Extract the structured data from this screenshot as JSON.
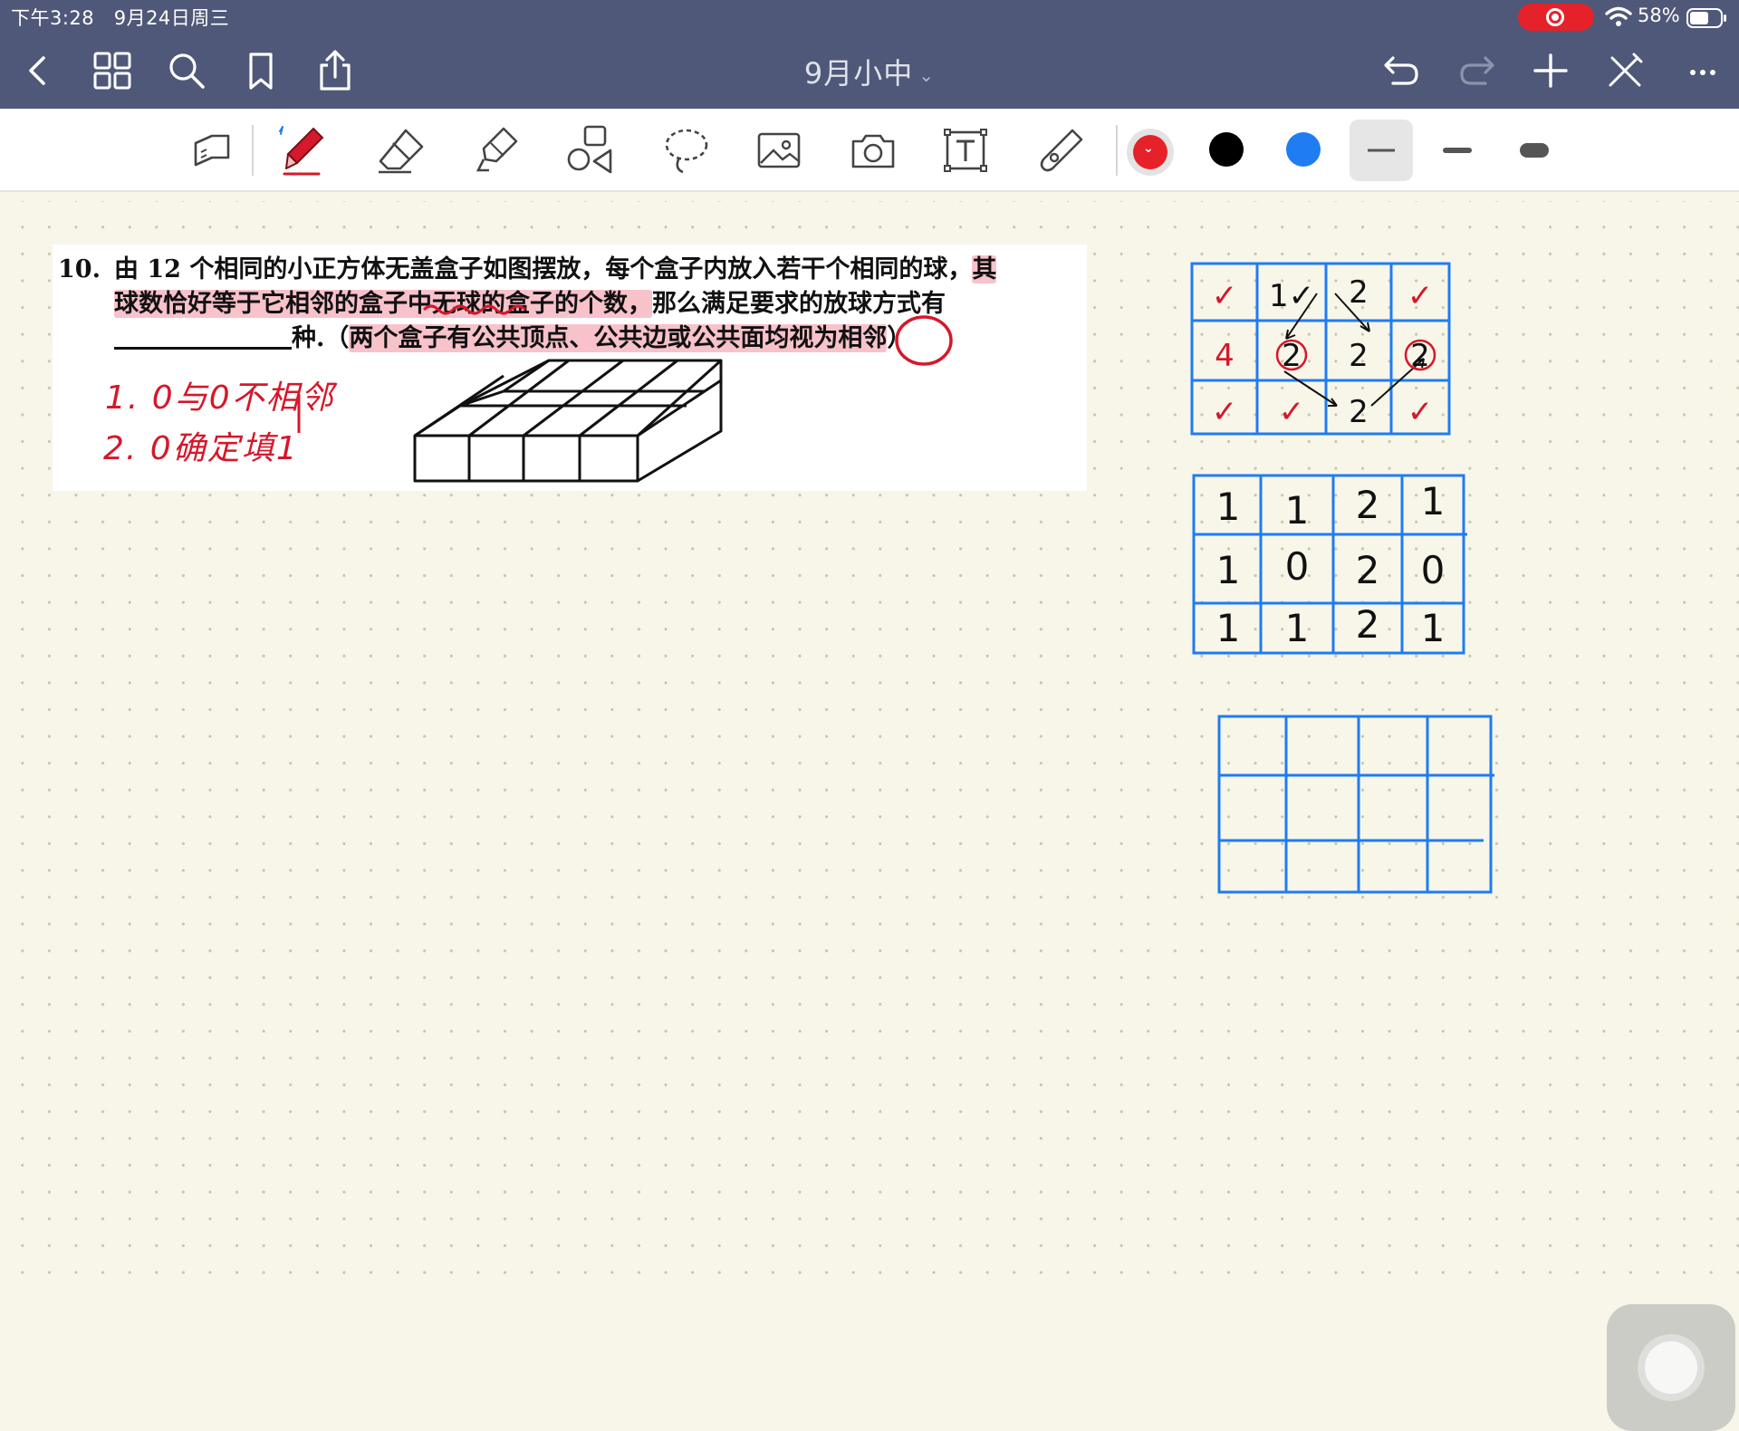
{
  "status_bar": {
    "time": "下午3:28",
    "date": "9月24日周三",
    "battery": "58%"
  },
  "nav": {
    "title": "9月小中",
    "icons_left": [
      "back-icon",
      "grid-icon",
      "search-icon",
      "bookmark-icon",
      "share-icon"
    ],
    "icons_right": [
      "undo-icon",
      "redo-icon",
      "plus-icon",
      "close-pen-icon",
      "more-icon"
    ]
  },
  "toolbar": {
    "tools": [
      "page-view-icon",
      "pen-icon",
      "eraser-icon",
      "highlighter-icon",
      "shapes-icon",
      "lasso-icon",
      "image-icon",
      "camera-icon",
      "text-icon",
      "laser-pointer-icon"
    ],
    "colors": [
      "#e5222a",
      "#000000",
      "#1f7cf2"
    ],
    "selected_color": "#e5222a",
    "stroke_widths": [
      "thin",
      "medium",
      "thick"
    ],
    "selected_stroke": "thin"
  },
  "problem": {
    "number": "10.",
    "line1_a": "由 12 个相同的小正方体无盖盒子如图摆放，每个盒子内放入若干个相同的球，",
    "line1_b": "其",
    "line2_a": "球数恰好等于它相邻的盒子中无球的盒子的个数，",
    "line2_b": "那么满足要求的放球方式有",
    "line3_a": "种.（",
    "line3_b": "两个盒子有公共顶点、公共边或公共面均视为相邻",
    "line3_c": "）"
  },
  "handwritten_notes": {
    "note1": "1. 0与0不相邻",
    "note2": "2. 0确定填1"
  },
  "grids": {
    "grid1": {
      "rows": [
        [
          "✓",
          "1✓",
          "2",
          "✓"
        ],
        [
          "4",
          "2",
          "2",
          "2"
        ],
        [
          "✓",
          "✓",
          "2",
          "✓"
        ]
      ]
    },
    "grid2": {
      "rows": [
        [
          "1",
          "1",
          "2",
          "1"
        ],
        [
          "1",
          "0",
          "2",
          "0"
        ],
        [
          "1",
          "1",
          "2",
          "1"
        ]
      ]
    },
    "grid3": {
      "rows": [
        [
          "",
          "",
          "",
          ""
        ],
        [
          "",
          "",
          "",
          ""
        ],
        [
          "",
          "",
          "",
          ""
        ]
      ]
    }
  }
}
